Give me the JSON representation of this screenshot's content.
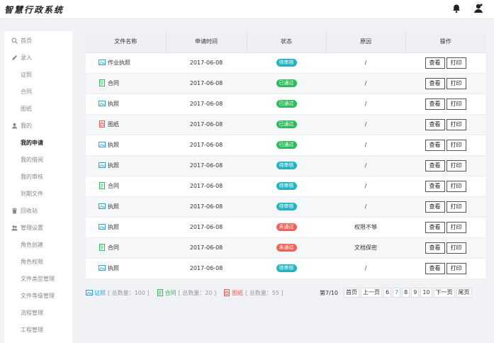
{
  "header": {
    "title": "智慧行政系统"
  },
  "sidebar": {
    "items": [
      {
        "label": "首页",
        "type": "top",
        "icon": "search-icon"
      },
      {
        "label": "录入",
        "type": "top",
        "icon": "pen-icon"
      },
      {
        "label": "证照",
        "type": "sub"
      },
      {
        "label": "合同",
        "type": "sub"
      },
      {
        "label": "图纸",
        "type": "sub"
      },
      {
        "label": "我的",
        "type": "top",
        "icon": "user-icon"
      },
      {
        "label": "我的申请",
        "type": "sub",
        "active": true
      },
      {
        "label": "我的借阅",
        "type": "sub"
      },
      {
        "label": "我的审核",
        "type": "sub"
      },
      {
        "label": "到期文件",
        "type": "sub"
      },
      {
        "label": "回收站",
        "type": "top",
        "icon": "trash-icon"
      },
      {
        "label": "管理设置",
        "type": "top",
        "icon": "users-icon"
      },
      {
        "label": "角色创建",
        "type": "sub"
      },
      {
        "label": "角色权限",
        "type": "sub"
      },
      {
        "label": "文件类型管理",
        "type": "sub"
      },
      {
        "label": "文件等级管理",
        "type": "sub"
      },
      {
        "label": "流程管理",
        "type": "sub"
      },
      {
        "label": "工程管理",
        "type": "sub"
      }
    ]
  },
  "table": {
    "columns": [
      "文件名称",
      "申请时间",
      "状态",
      "原因",
      "操作"
    ],
    "view_label": "查看",
    "print_label": "打印",
    "rows": [
      {
        "icon": "license-icon",
        "name": "作业执照",
        "date": "2017-06-08",
        "status": "待审核",
        "reason": "/"
      },
      {
        "icon": "contract-icon",
        "name": "合同",
        "date": "2017-06-08",
        "status": "已通过",
        "reason": "/"
      },
      {
        "icon": "license-icon",
        "name": "执照",
        "date": "2017-06-08",
        "status": "已通过",
        "reason": "/"
      },
      {
        "icon": "drawing-icon",
        "name": "图纸",
        "date": "2017-06-08",
        "status": "已通过",
        "reason": "/"
      },
      {
        "icon": "license-icon",
        "name": "执照",
        "date": "2017-06-08",
        "status": "已通过",
        "reason": "/"
      },
      {
        "icon": "license-icon",
        "name": "执照",
        "date": "2017-06-08",
        "status": "待审核",
        "reason": "/"
      },
      {
        "icon": "contract-icon",
        "name": "合同",
        "date": "2017-06-08",
        "status": "待审核",
        "reason": "/"
      },
      {
        "icon": "license-icon",
        "name": "执照",
        "date": "2017-06-08",
        "status": "待审核",
        "reason": "/"
      },
      {
        "icon": "license-icon",
        "name": "执照",
        "date": "2017-06-08",
        "status": "未通过",
        "reason": "权限不够"
      },
      {
        "icon": "contract-icon",
        "name": "合同",
        "date": "2017-06-08",
        "status": "未通过",
        "reason": "文档保密"
      },
      {
        "icon": "license-icon",
        "name": "执照",
        "date": "2017-06-08",
        "status": "待审核",
        "reason": "/"
      }
    ]
  },
  "status_colors": {
    "待审核": "#25b3c0",
    "已通过": "#2dbb5b",
    "未通过": "#f0625a"
  },
  "legend": [
    {
      "icon": "license-icon",
      "label": "证照",
      "count": "[ 总数量：100 ]",
      "color": "#2aa3d6"
    },
    {
      "icon": "contract-icon",
      "label": "合同",
      "count": "[ 总数量：20 ]",
      "color": "#2dbb5b"
    },
    {
      "icon": "drawing-icon",
      "label": "图纸",
      "count": "[ 总数量：55 ]",
      "color": "#e05a4f"
    }
  ],
  "pager": {
    "info": "第7/10",
    "first": "首页",
    "prev": "上一页",
    "pages": [
      "6",
      "7",
      "8",
      "9",
      "10"
    ],
    "current": "7",
    "next": "下一页",
    "last": "尾页"
  }
}
